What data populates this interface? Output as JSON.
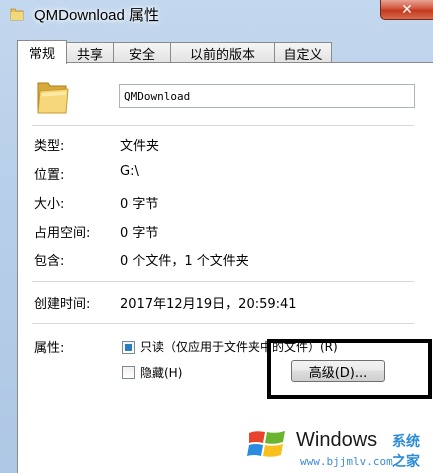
{
  "window": {
    "title": "QMDownload 属性",
    "close_label": "✕"
  },
  "tabs": [
    {
      "label": "常规",
      "active": true
    },
    {
      "label": "共享"
    },
    {
      "label": "安全"
    },
    {
      "label": "以前的版本"
    },
    {
      "label": "自定义"
    }
  ],
  "general": {
    "folder_name": "QMDownload",
    "rows": [
      {
        "label": "类型:",
        "value": "文件夹"
      },
      {
        "label": "位置:",
        "value": "G:\\"
      },
      {
        "label": "大小:",
        "value": "0 字节"
      },
      {
        "label": "占用空间:",
        "value": "0 字节"
      },
      {
        "label": "包含:",
        "value": "0 个文件，1 个文件夹"
      }
    ],
    "created_label": "创建时间:",
    "created_value": "2017年12月19日，20:59:41",
    "attributes_label": "属性:",
    "readonly_label": "只读（仅应用于文件夹中的文件）(R)",
    "hidden_label": "隐藏(H)",
    "advanced_button": "高级(D)..."
  },
  "watermark": {
    "brand": "Windows",
    "cn_text": "系统之家",
    "url": "www.bjjmlv.com"
  },
  "colors": {
    "accent": "#2a7ec0",
    "close": "#c23a1f",
    "highlight": "#000000"
  }
}
